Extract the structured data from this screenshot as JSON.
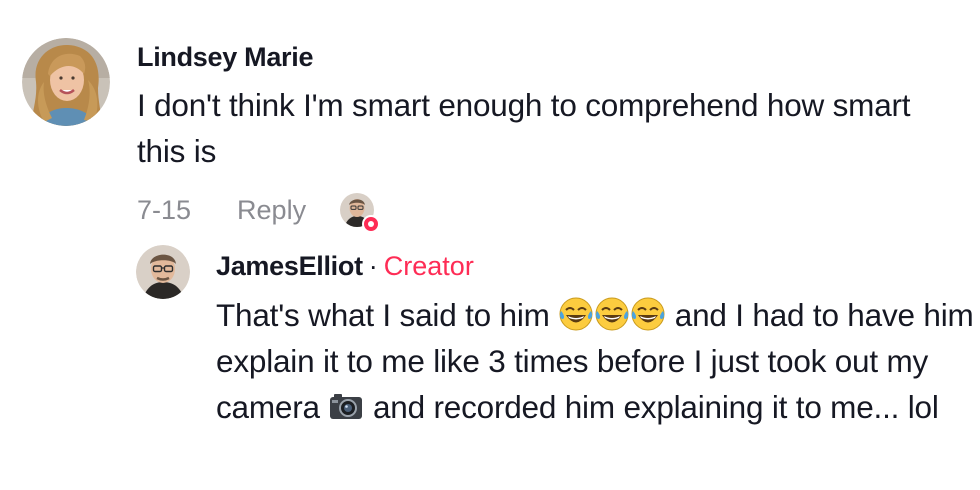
{
  "comment": {
    "author": "Lindsey Marie",
    "text": "I don't think I'm smart enough to comprehend how smart this is",
    "date": "7-15",
    "reply_label": "Reply",
    "liked_by_creator": true,
    "avatar_icon": "user-avatar-icon",
    "liked_icon": "creator-liked-avatar-icon"
  },
  "reply": {
    "author": "JamesElliot",
    "separator": "·",
    "badge": "Creator",
    "text_1": "That's what I said to him",
    "text_2": " and I had to have him explain it to me like 3 times before I just took out my camera",
    "text_3": " and recorded him explaining it to me... lol",
    "emoji_laughing": "😂",
    "emoji_camera": "📷",
    "avatar_icon": "creator-avatar-icon"
  },
  "colors": {
    "accent": "#fe2c55",
    "text": "#161823",
    "muted": "#8a8b91"
  }
}
